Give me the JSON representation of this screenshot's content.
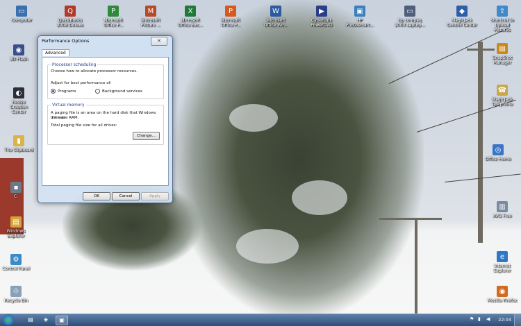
{
  "desktop_icons": [
    {
      "label": "Computer",
      "icon": "computer-icon",
      "color": "#3a6fb0",
      "glyph": "▭"
    },
    {
      "label": "QuickBooks 2008 Deluxe",
      "icon": "quickbooks-icon",
      "color": "#b23a2a",
      "glyph": "Q"
    },
    {
      "label": "Microsoft Office P...",
      "icon": "office-icon",
      "color": "#2f8a3a",
      "glyph": "P"
    },
    {
      "label": "Microsoft Picture ...",
      "icon": "picture-icon",
      "color": "#b84a2a",
      "glyph": "M"
    },
    {
      "label": "Microsoft Office Exc...",
      "icon": "excel-icon",
      "color": "#1f7a3a",
      "glyph": "X"
    },
    {
      "label": "Microsoft Office P...",
      "icon": "powerpoint-icon",
      "color": "#d45a1f",
      "glyph": "P"
    },
    {
      "label": "Microsoft Office Wo...",
      "icon": "word-icon",
      "color": "#2c5aa0",
      "glyph": "W"
    },
    {
      "label": "CyberLink PowerDVD",
      "icon": "powerdvd-icon",
      "color": "#2a3f8a",
      "glyph": "▶"
    },
    {
      "label": "HP Photosmart...",
      "icon": "hp-photosmart-icon",
      "color": "#3a7fc0",
      "glyph": "▣"
    },
    {
      "label": "hp compaq 2000 Laptop...",
      "icon": "laptop-icon",
      "color": "#4f5f7a",
      "glyph": "▭"
    },
    {
      "label": "MagicJack Control Center",
      "icon": "magicjack-icon",
      "color": "#2d5fa8",
      "glyph": "◆"
    },
    {
      "label": "Shortcut to Upload Pictures",
      "icon": "upload-icon",
      "color": "#3f8ac8",
      "glyph": "⇪"
    },
    {
      "label": "3D Flash",
      "icon": "flash-icon",
      "color": "#3a4f8a",
      "glyph": "◉"
    },
    {
      "label": "SnapShot Manager",
      "icon": "snapshot-icon",
      "color": "#c88a1f",
      "glyph": "▤"
    },
    {
      "label": "Resize Creation Center",
      "icon": "resize-icon",
      "color": "#2a2f3a",
      "glyph": "◐"
    },
    {
      "label": "MagicJack Telephone",
      "icon": "magicjack-phone-icon",
      "color": "#c8a84a",
      "glyph": "☎"
    },
    {
      "label": "The Clipboard",
      "icon": "folder-icon",
      "color": "#d9b44a",
      "glyph": "▮"
    },
    {
      "label": "Office Home",
      "icon": "office-home-icon",
      "color": "#3a74c8",
      "glyph": "◎"
    },
    {
      "label": "C:",
      "icon": "drive-icon",
      "color": "#6a7a8a",
      "glyph": "▪"
    },
    {
      "label": "Windows Explorer",
      "icon": "explorer-icon",
      "color": "#d2a43a",
      "glyph": "▤"
    },
    {
      "label": "AVG Free",
      "icon": "avg-icon",
      "color": "#7a8aa0",
      "glyph": "▥"
    },
    {
      "label": "Control Panel",
      "icon": "control-panel-icon",
      "color": "#3a8ac8",
      "glyph": "⚙"
    },
    {
      "label": "Internet Explorer",
      "icon": "ie-icon",
      "color": "#2f78c8",
      "glyph": "e"
    },
    {
      "label": "Recycle Bin",
      "icon": "recycle-bin-icon",
      "color": "#8aa0b8",
      "glyph": "♲"
    },
    {
      "label": "Mozilla Firefox",
      "icon": "firefox-icon",
      "color": "#d46a1f",
      "glyph": "◉"
    }
  ],
  "dialog": {
    "title": "Performance Options",
    "close_glyph": "✕",
    "tab_label": "Advanced",
    "processor": {
      "heading": "Processor scheduling",
      "description": "Choose how to allocate processor resources.",
      "adjust_label": "Adjust for best performance of:",
      "programs_label": "Programs",
      "background_label": "Background services"
    },
    "virtual_memory": {
      "heading": "Virtual memory",
      "description_line1": "A paging file is an area on the hard disk that Windows uses as",
      "description_line2": "if it were RAM.",
      "total_label": "Total paging file size for all drives:",
      "change_label": "Change..."
    },
    "ok_label": "OK",
    "cancel_label": "Cancel",
    "apply_label": "Apply"
  },
  "taskbar": {
    "clock": "22:04",
    "buttons": [
      {
        "icon": "folder-taskbar-icon",
        "glyph": "▤"
      },
      {
        "icon": "shield-taskbar-icon",
        "glyph": "◈"
      },
      {
        "icon": "system-properties-taskbar-icon",
        "glyph": "▣"
      }
    ],
    "tray_icons": [
      {
        "icon": "flag-tray-icon",
        "glyph": "⚑"
      },
      {
        "icon": "network-tray-icon",
        "glyph": "▮"
      },
      {
        "icon": "volume-tray-icon",
        "glyph": "◀"
      }
    ]
  }
}
